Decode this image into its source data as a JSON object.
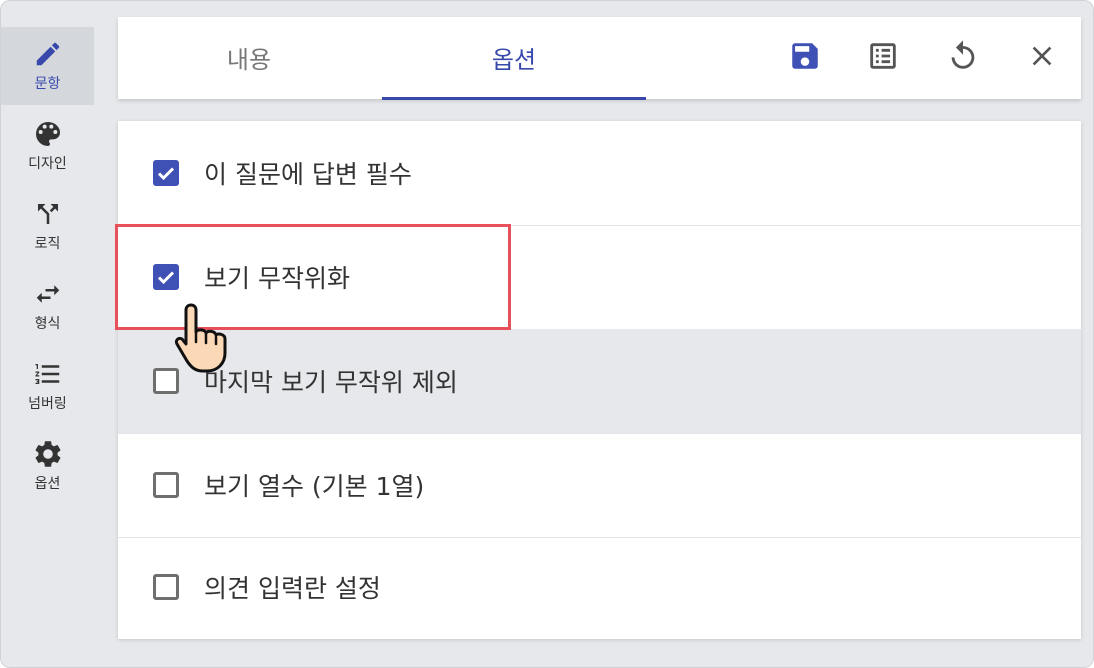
{
  "sidebar": {
    "items": [
      {
        "label": "문항",
        "icon": "pencil-icon",
        "active": true
      },
      {
        "label": "디자인",
        "icon": "palette-icon",
        "active": false
      },
      {
        "label": "로직",
        "icon": "branch-icon",
        "active": false
      },
      {
        "label": "형식",
        "icon": "swap-icon",
        "active": false
      },
      {
        "label": "넘버링",
        "icon": "numbered-list-icon",
        "active": false
      },
      {
        "label": "옵션",
        "icon": "gear-icon",
        "active": false
      }
    ]
  },
  "tabs": {
    "content_label": "내용",
    "options_label": "옵션",
    "active": "옵션"
  },
  "toolbar": {
    "icons": [
      "save-icon",
      "list-icon",
      "refresh-icon",
      "close-icon"
    ]
  },
  "options": [
    {
      "label": "이 질문에 답변 필수",
      "checked": true
    },
    {
      "label": "보기 무작위화",
      "checked": true
    },
    {
      "label": "마지막 보기 무작위 제외",
      "checked": false
    },
    {
      "label": "보기 열수 (기본 1열)",
      "checked": false
    },
    {
      "label": "의견 입력란 설정",
      "checked": false
    }
  ],
  "colors": {
    "accent": "#3f51b5",
    "highlight": "#e8505b",
    "sidebar_bg": "#e6e8eb"
  }
}
